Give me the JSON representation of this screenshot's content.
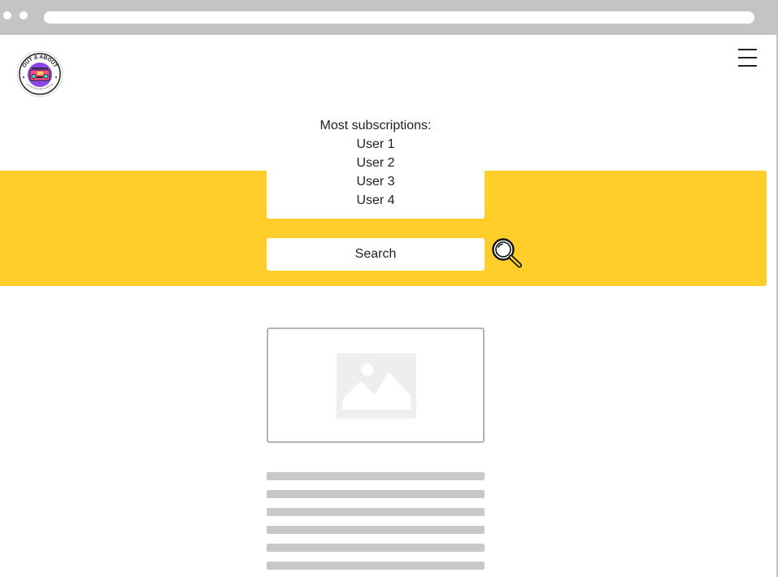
{
  "subscriptions": {
    "title": "Most subscriptions:",
    "users": [
      "User 1",
      "User 2",
      "User 3",
      "User 4"
    ]
  },
  "search": {
    "placeholder": "Search"
  },
  "logo": {
    "top_text": "OUT & ABOUT"
  },
  "icons": {
    "menu": "hamburger-menu-icon",
    "search": "magnifier-icon",
    "image": "image-placeholder-icon"
  },
  "colors": {
    "accent": "#ffce2b",
    "chrome": "#c4c4c4",
    "placeholder_gray": "#c8c8c8",
    "logo_purple": "#8a47e6"
  }
}
